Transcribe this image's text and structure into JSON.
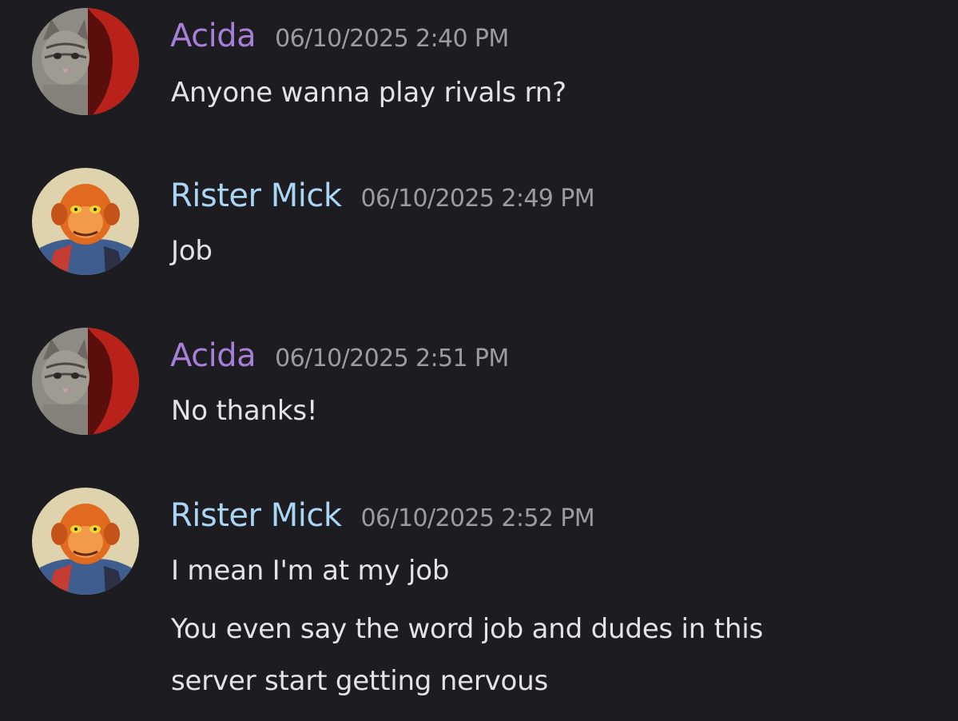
{
  "messages": [
    {
      "author": "Acida",
      "timestamp": "06/10/2025 2:40 PM",
      "lines": [
        "Anyone wanna play rivals rn?"
      ]
    },
    {
      "author": "Rister Mick",
      "timestamp": "06/10/2025 2:49 PM",
      "lines": [
        "Job"
      ]
    },
    {
      "author": "Acida",
      "timestamp": "06/10/2025 2:51 PM",
      "lines": [
        "No thanks!"
      ]
    },
    {
      "author": "Rister Mick",
      "timestamp": "06/10/2025 2:52 PM",
      "lines": [
        "I mean I'm at my job",
        "You even say the word job and dudes in this",
        "server start getting nervous"
      ]
    }
  ],
  "colors": {
    "background": "#1c1c21",
    "acida_name": "#a77fd6",
    "rister_name": "#a9d6f5",
    "timestamp": "#9a9ba3",
    "message_text": "#e2e3e7"
  },
  "icons": {
    "acida_avatar": "cat-and-red-figure-avatar",
    "rister_avatar": "orange-monkey-avatar"
  }
}
